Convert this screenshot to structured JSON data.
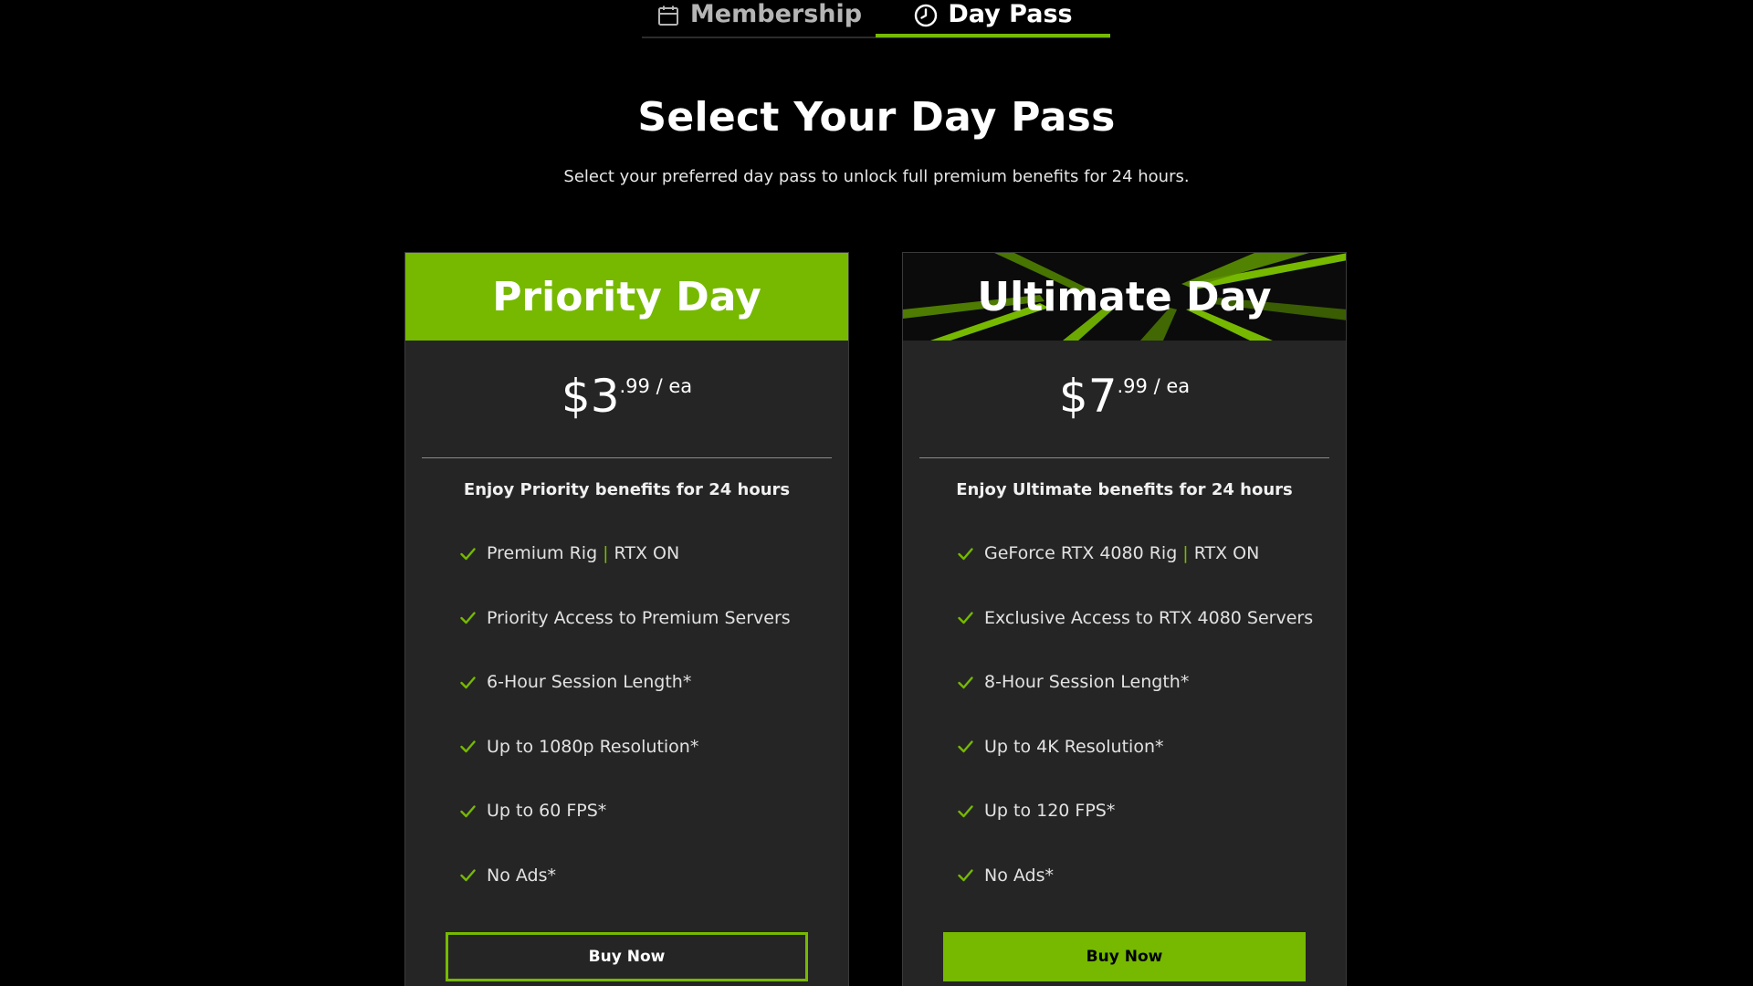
{
  "tabs": {
    "membership": {
      "label": "Membership",
      "icon": "calendar-icon"
    },
    "daypass": {
      "label": "Day Pass",
      "icon": "clock-icon",
      "active": true
    }
  },
  "header": {
    "title": "Select Your Day Pass",
    "subtitle": "Select your preferred day pass to unlock full premium benefits for 24 hours."
  },
  "colors": {
    "accent": "#76b900",
    "background": "#000000",
    "card": "#252525"
  },
  "plans": {
    "priority": {
      "title": "Priority Day",
      "currency": "$",
      "dollars": "3",
      "cents_unit": ".99 / ea",
      "benefit_title": "Enjoy Priority benefits for 24 hours",
      "features": {
        "f1_a": "Premium Rig",
        "f1_sep": "|",
        "f1_b": "RTX ON",
        "f2": "Priority Access to Premium Servers",
        "f3": "6-Hour Session Length*",
        "f4": "Up to 1080p Resolution*",
        "f5": "Up to 60 FPS*",
        "f6": "No Ads*"
      },
      "button": "Buy Now"
    },
    "ultimate": {
      "title": "Ultimate Day",
      "currency": "$",
      "dollars": "7",
      "cents_unit": ".99 / ea",
      "benefit_title": "Enjoy Ultimate benefits for 24 hours",
      "features": {
        "f1_a": "GeForce RTX 4080 Rig",
        "f1_sep": "|",
        "f1_b": "RTX ON",
        "f2": "Exclusive Access to RTX 4080 Servers",
        "f3": "8-Hour Session Length*",
        "f4": "Up to 4K Resolution*",
        "f5": "Up to 120 FPS*",
        "f6": "No Ads*"
      },
      "button": "Buy Now"
    }
  }
}
